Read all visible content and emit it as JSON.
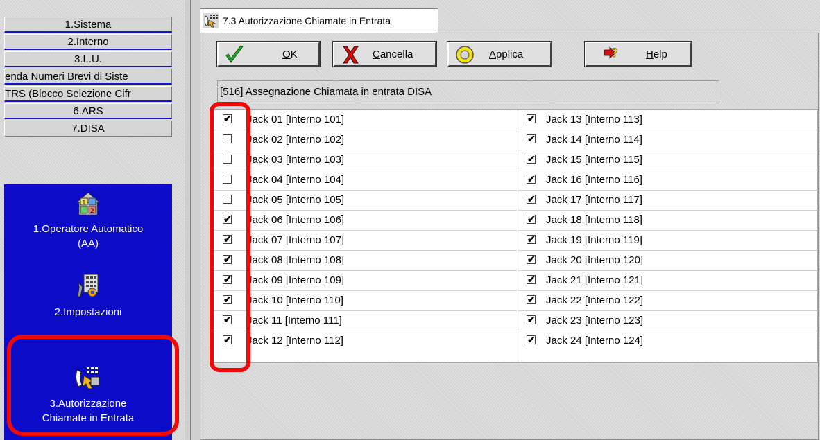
{
  "menu": {
    "items": [
      {
        "label": "1.Sistema"
      },
      {
        "label": "2.Interno"
      },
      {
        "label": "3.L.U."
      },
      {
        "label": "enda Numeri Brevi di Siste"
      },
      {
        "label": "TRS (Blocco Selezione Cifr"
      },
      {
        "label": "6.ARS"
      },
      {
        "label": "7.DISA"
      }
    ]
  },
  "nav": {
    "items": [
      {
        "label_line1": "1.Operatore Automatico",
        "label_line2": "(AA)",
        "icon": "operator-icon"
      },
      {
        "label_line1": "2.Impostazioni",
        "label_line2": "",
        "icon": "settings-icon"
      },
      {
        "label_line1": "3.Autorizzazione",
        "label_line2": "Chiamate in Entrata",
        "icon": "incoming-call-icon"
      }
    ],
    "highlight_color": "#ef0a0a",
    "panel_color": "#0c0cc8"
  },
  "tab": {
    "label": "7.3 Autorizzazione Chiamate in Entrata"
  },
  "toolbar": {
    "ok_label": "OK",
    "ok_mnemonic": "O",
    "cancel_label": "ancella",
    "cancel_mnemonic": "C",
    "apply_label": "pplica",
    "apply_mnemonic": "A",
    "help_label": "elp",
    "help_mnemonic": "H"
  },
  "description": "[516] Assegnazione Chiamata in entrata DISA",
  "jacks_left": [
    {
      "label": "Jack 01 [Interno 101]",
      "checked": true
    },
    {
      "label": "Jack 02 [Interno 102]",
      "checked": false
    },
    {
      "label": "Jack 03 [Interno 103]",
      "checked": false
    },
    {
      "label": "Jack 04 [Interno 104]",
      "checked": false
    },
    {
      "label": "Jack 05 [Interno 105]",
      "checked": false
    },
    {
      "label": "Jack 06 [Interno 106]",
      "checked": true
    },
    {
      "label": "Jack 07 [Interno 107]",
      "checked": true
    },
    {
      "label": "Jack 08 [Interno 108]",
      "checked": true
    },
    {
      "label": "Jack 09 [Interno 109]",
      "checked": true
    },
    {
      "label": "Jack 10 [Interno 110]",
      "checked": true
    },
    {
      "label": "Jack 11 [Interno 111]",
      "checked": true
    },
    {
      "label": "Jack 12 [Interno 112]",
      "checked": true
    }
  ],
  "jacks_right": [
    {
      "label": "Jack 13 [Interno 113]",
      "checked": true
    },
    {
      "label": "Jack 14 [Interno 114]",
      "checked": true
    },
    {
      "label": "Jack 15 [Interno 115]",
      "checked": true
    },
    {
      "label": "Jack 16 [Interno 116]",
      "checked": true
    },
    {
      "label": "Jack 17 [Interno 117]",
      "checked": true
    },
    {
      "label": "Jack 18 [Interno 118]",
      "checked": true
    },
    {
      "label": "Jack 19 [Interno 119]",
      "checked": true
    },
    {
      "label": "Jack 20 [Interno 120]",
      "checked": true
    },
    {
      "label": "Jack 21 [Interno 121]",
      "checked": true
    },
    {
      "label": "Jack 22 [Interno 122]",
      "checked": true
    },
    {
      "label": "Jack 23 [Interno 123]",
      "checked": true
    },
    {
      "label": "Jack 24 [Interno 124]",
      "checked": true
    }
  ]
}
